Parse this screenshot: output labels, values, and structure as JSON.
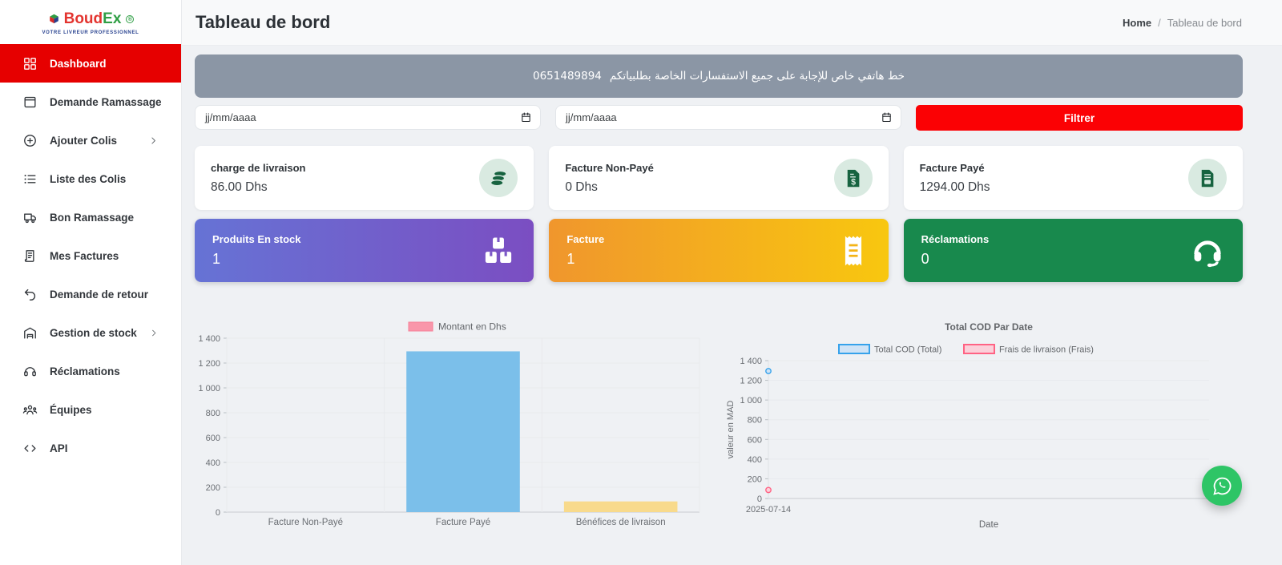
{
  "brand": {
    "name_left": "Boud",
    "name_right": "Ex",
    "registered": "®",
    "tagline": "VOTRE LIVREUR PROFESSIONNEL"
  },
  "sidebar": {
    "items": [
      {
        "label": "Dashboard",
        "icon": "dashboard",
        "active": true,
        "chevron": false
      },
      {
        "label": "Demande Ramassage",
        "icon": "archive",
        "active": false,
        "chevron": false
      },
      {
        "label": "Ajouter Colis",
        "icon": "plus-circle",
        "active": false,
        "chevron": true
      },
      {
        "label": "Liste des Colis",
        "icon": "list",
        "active": false,
        "chevron": false
      },
      {
        "label": "Bon Ramassage",
        "icon": "truck",
        "active": false,
        "chevron": false
      },
      {
        "label": "Mes Factures",
        "icon": "invoice",
        "active": false,
        "chevron": false
      },
      {
        "label": "Demande de retour",
        "icon": "undo",
        "active": false,
        "chevron": false
      },
      {
        "label": "Gestion de stock",
        "icon": "warehouse",
        "active": false,
        "chevron": true
      },
      {
        "label": "Réclamations",
        "icon": "headset",
        "active": false,
        "chevron": false
      },
      {
        "label": "Équipes",
        "icon": "team",
        "active": false,
        "chevron": false
      },
      {
        "label": "API",
        "icon": "code",
        "active": false,
        "chevron": false
      }
    ]
  },
  "header": {
    "title": "Tableau de bord",
    "breadcrumb": {
      "home": "Home",
      "sep": "/",
      "current": "Tableau de bord"
    }
  },
  "banner": {
    "text": "خط هاتفي خاص للإجابة على جميع الاستفسارات الخاصة بطلبياتكم",
    "phone": "0651489894",
    "bg_color": "#8b96a5"
  },
  "filters": {
    "date_from_placeholder": "jj/mm/aaaa",
    "date_to_placeholder": "jj/mm/aaaa",
    "button_label": "Filtrer",
    "button_color": "#fb0104"
  },
  "stat_cards": [
    {
      "title": "charge de livraison",
      "value": "86.00 Dhs",
      "icon": "coins"
    },
    {
      "title": "Facture Non-Payé",
      "value": "0 Dhs",
      "icon": "invoice-dollar"
    },
    {
      "title": "Facture Payé",
      "value": "1294.00 Dhs",
      "icon": "invoice-file"
    }
  ],
  "metric_cards": [
    {
      "title": "Produits En stock",
      "value": "1",
      "icon": "boxes",
      "color_from": "#6673d5",
      "color_to": "#7b4ec2",
      "icon_accent": "#7b57c6"
    },
    {
      "title": "Facture",
      "value": "1",
      "icon": "receipt",
      "color_from": "#f0962d",
      "color_to": "#f8c70f",
      "icon_accent": "#f4b417"
    },
    {
      "title": "Réclamations",
      "value": "0",
      "icon": "headset-filled",
      "color_from": "#18894d",
      "color_to": "#18894d",
      "icon_accent": "#18894d"
    }
  ],
  "chart_data": [
    {
      "type": "bar",
      "legend": [
        "Montant en Dhs"
      ],
      "legend_fill": "#f996aa",
      "legend_stroke": "#f67e96",
      "categories": [
        "Facture Non-Payé",
        "Facture Payé",
        "Bénéfices de livraison"
      ],
      "values": [
        0,
        1294,
        86
      ],
      "bar_colors": [
        "#7bbfea",
        "#7bbfea",
        "#f8da8c"
      ],
      "ylim": [
        0,
        1400
      ],
      "ytick_step": 200,
      "grid": true,
      "legend_position": "top"
    },
    {
      "type": "scatter",
      "title": "Total COD Par Date",
      "x": [
        "2025-07-14"
      ],
      "series": [
        {
          "name": "Total COD (Total)",
          "values": [
            1294
          ],
          "color": "#36a2eb",
          "fill": "#cfe3f6"
        },
        {
          "name": "Frais de livraison (Frais)",
          "values": [
            86
          ],
          "color": "#ff6384",
          "fill": "#fbd0da"
        }
      ],
      "ylabel": "valeur en MAD",
      "xlabel": "Date",
      "ylim": [
        0,
        1400
      ],
      "ytick_step": 200,
      "grid": true,
      "legend_position": "top"
    }
  ],
  "fab": {
    "name": "whatsapp",
    "color": "#2ec566"
  }
}
